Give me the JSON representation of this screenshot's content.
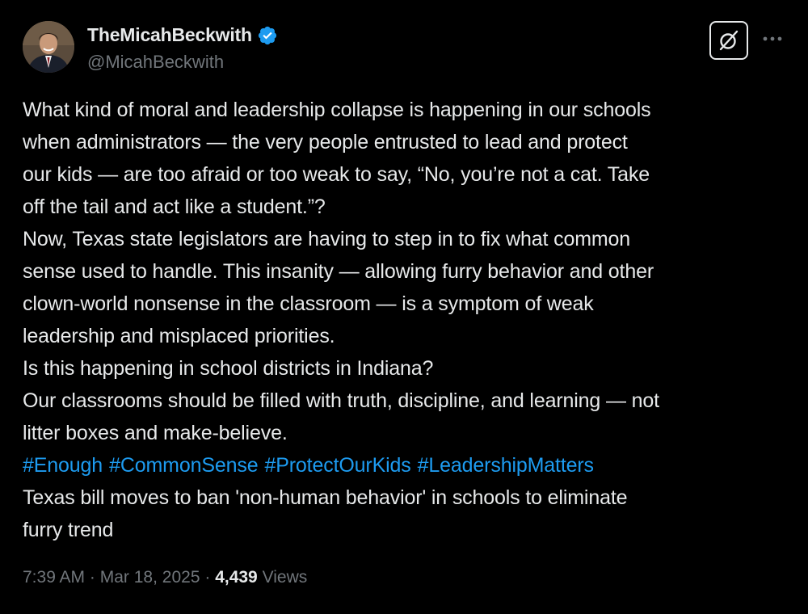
{
  "author": {
    "display_name": "TheMicahBeckwith",
    "handle": "@MicahBeckwith",
    "verified_icon": "verified-badge-icon",
    "verified_color": "#1d9bf0"
  },
  "actions": {
    "grok_icon": "grok-icon",
    "more_icon": "more-options-icon"
  },
  "post": {
    "lines": [
      "What kind of moral and leadership collapse is happening in our schools",
      "when administrators — the very people entrusted to lead and protect",
      "our kids — are too afraid or too weak to say, “No, you’re not a cat. Take",
      "off the tail and act like a student.”?",
      "Now, Texas state legislators are having to step in to fix what common",
      "sense used to handle. This insanity — allowing furry behavior and other",
      "clown-world nonsense in the classroom — is a symptom of weak",
      "leadership and misplaced priorities.",
      "Is this happening in school districts in Indiana?",
      "Our classrooms should be filled with truth, discipline, and learning — not",
      "litter boxes and make-believe."
    ],
    "hashtags": [
      "#Enough",
      "#CommonSense",
      "#ProtectOurKids",
      "#LeadershipMatters"
    ],
    "hashtag_color": "#1d9bf0",
    "link_lines": [
      "Texas bill moves to ban 'non-human behavior' in schools to eliminate",
      "furry trend"
    ]
  },
  "meta": {
    "time": "7:39 AM",
    "separator": "·",
    "date": "Mar 18, 2025",
    "views_count": "4,439",
    "views_label": "Views"
  },
  "colors": {
    "background": "#000000",
    "text": "#e7e9ea",
    "secondary_text": "#71767b"
  }
}
